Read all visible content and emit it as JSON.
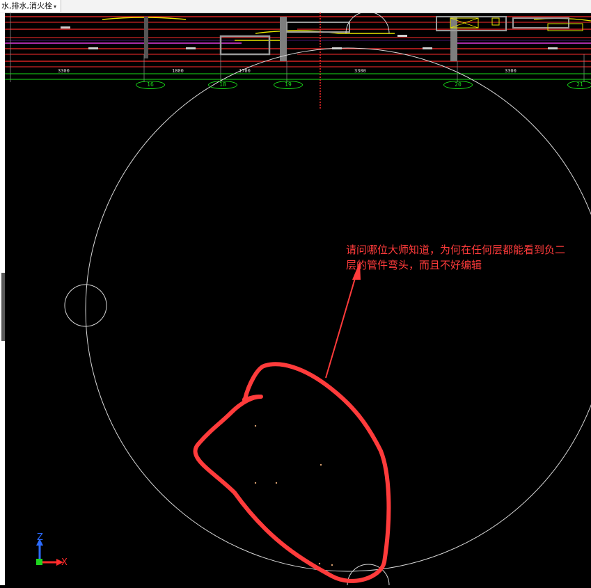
{
  "tab": {
    "title": "水,排水,消火栓",
    "dropdown_glyph": "▾"
  },
  "annotation": {
    "line1": "请问哪位大师知道，为何在任何层都能看到负二",
    "line2": "层的管件弯头，而且不好编辑"
  },
  "grid_bubbles": [
    "16",
    "18",
    "19",
    "20",
    "21"
  ],
  "dimensions": [
    "3300",
    "1800",
    "1700",
    "3300",
    "3300"
  ],
  "ucs": {
    "x_label": "X",
    "z_label": "Z"
  },
  "colors": {
    "canvas_bg": "#000000",
    "grid_line": "#19e019",
    "wall_red": "#ff2b2b",
    "pipe_magenta": "#e03ce0",
    "pipe_yellow": "#e6e600",
    "circle": "#d8d8d8",
    "markup": "#ff3b3b"
  }
}
